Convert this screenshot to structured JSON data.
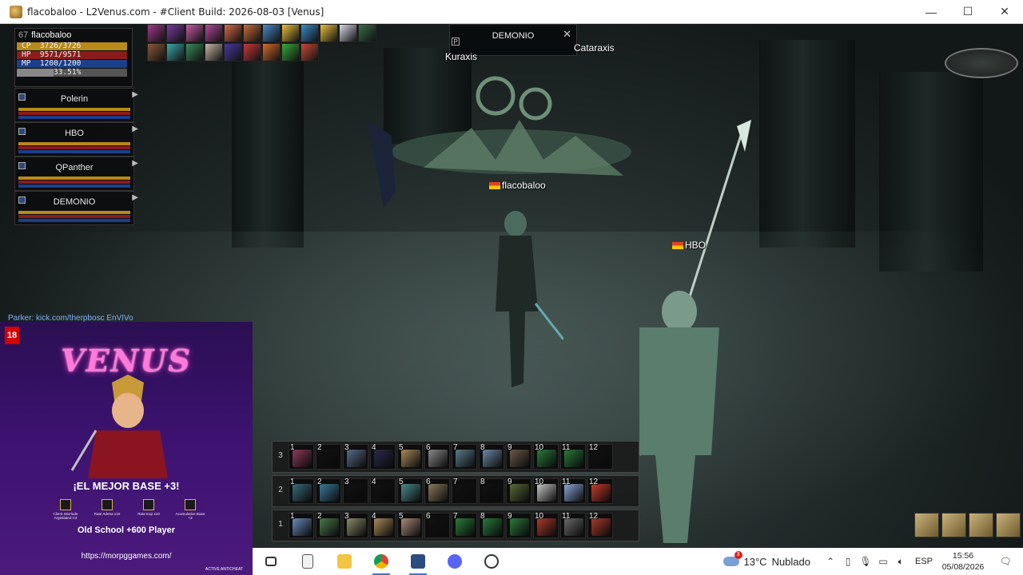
{
  "window": {
    "title": "flacobaloo - L2Venus.com - #Client Build: 2026-08-03 [Venus]",
    "minimize_glyph": "—",
    "maximize_glyph": "☐",
    "close_glyph": "✕"
  },
  "status": {
    "level": "67",
    "name": "flacobaloo",
    "cp_label": "CP",
    "cp_value": "3726/3726",
    "cp_fill": 1.0,
    "hp_label": "HP",
    "hp_value": "9571/9571",
    "hp_fill": 1.0,
    "mp_label": "MP",
    "mp_value": "1200/1200",
    "mp_fill": 1.0,
    "xp_value": "33.51%",
    "xp_fill": 0.3351
  },
  "party": [
    {
      "name": "Polerin"
    },
    {
      "name": "HBO"
    },
    {
      "name": "QPanther"
    },
    {
      "name": "DEMONIO"
    }
  ],
  "target": {
    "name": "DEMONIO",
    "close_glyph": "✕",
    "btn_p": "P"
  },
  "world_tags": {
    "player": "flacobaloo",
    "ally": "HBO",
    "npc_left": "Kuraxis",
    "npc_right": "Cataraxis"
  },
  "chat": {
    "line": "Parker: kick.com/therpbosc EnVIVo"
  },
  "overlay": {
    "age_badge": "18",
    "logo": "VENUS",
    "slogan": "¡EL MEJOR BASE +3!",
    "perks": [
      {
        "label": "Client Interlude Argetilated C4"
      },
      {
        "label": "Rate Adena x10"
      },
      {
        "label": "Rate Exp x10"
      },
      {
        "label": "Acumulative Base +3"
      }
    ],
    "subtitle": "Old School +600 Player",
    "url": "https://morpggames.com/",
    "anticheat": "ACTIVE ANTICHEAT"
  },
  "hotbars": [
    {
      "row": "3",
      "slots": [
        "1",
        "2",
        "3",
        "4",
        "5",
        "6",
        "7",
        "8",
        "9",
        "10",
        "11",
        "12"
      ]
    },
    {
      "row": "2",
      "slots": [
        "1",
        "2",
        "3",
        "4",
        "5",
        "6",
        "7",
        "8",
        "9",
        "10",
        "11",
        "12"
      ]
    },
    {
      "row": "1",
      "slots": [
        "1",
        "2",
        "3",
        "4",
        "5",
        "6",
        "7",
        "8",
        "9",
        "10",
        "11",
        "12"
      ]
    }
  ],
  "taskbar": {
    "weather_temp": "13°C",
    "weather_desc": "Nublado",
    "weather_badge": "3",
    "lang": "ESP",
    "time": "15:56",
    "date": "05/08/2026"
  },
  "colors": {
    "cp": "#b88a1a",
    "hp": "#8a1c1c",
    "mp": "#1c3f8a",
    "overlay_bg": "#3c1270"
  }
}
